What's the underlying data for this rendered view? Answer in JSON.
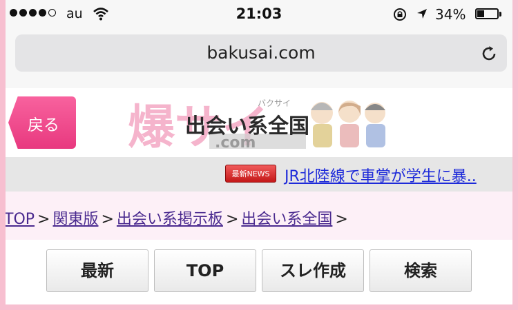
{
  "status_bar": {
    "signal": {
      "filled": 4,
      "total": 5
    },
    "carrier": "au",
    "time": "21:03",
    "battery_percent": "34%",
    "battery_level": 0.34,
    "icons": [
      "wifi-icon",
      "orientation-lock-icon",
      "location-arrow-icon",
      "battery-icon"
    ]
  },
  "browser": {
    "url": "bakusai.com",
    "reload_icon": "reload-icon"
  },
  "header": {
    "back_label": "戻る",
    "logo_text": "爆サイ.com",
    "logo_kana": "バクサイ",
    "title": "出会い系全国"
  },
  "news": {
    "badge": "最新NEWS",
    "headline": "JR北陸線で車掌が学生に暴.."
  },
  "breadcrumb": {
    "items": [
      "TOP",
      "関東版",
      "出会い系掲示板",
      "出会い系全国"
    ],
    "separator": ">"
  },
  "actions": {
    "latest": "最新",
    "top": "TOP",
    "create_thread": "スレ作成",
    "search": "検索"
  },
  "colors": {
    "frame": "#f7bfd0",
    "back_button": "#f04a8c",
    "news_link": "#1d2ad9",
    "breadcrumb_link": "#4a2a8f",
    "breadcrumb_bg": "#fdf0f7"
  }
}
